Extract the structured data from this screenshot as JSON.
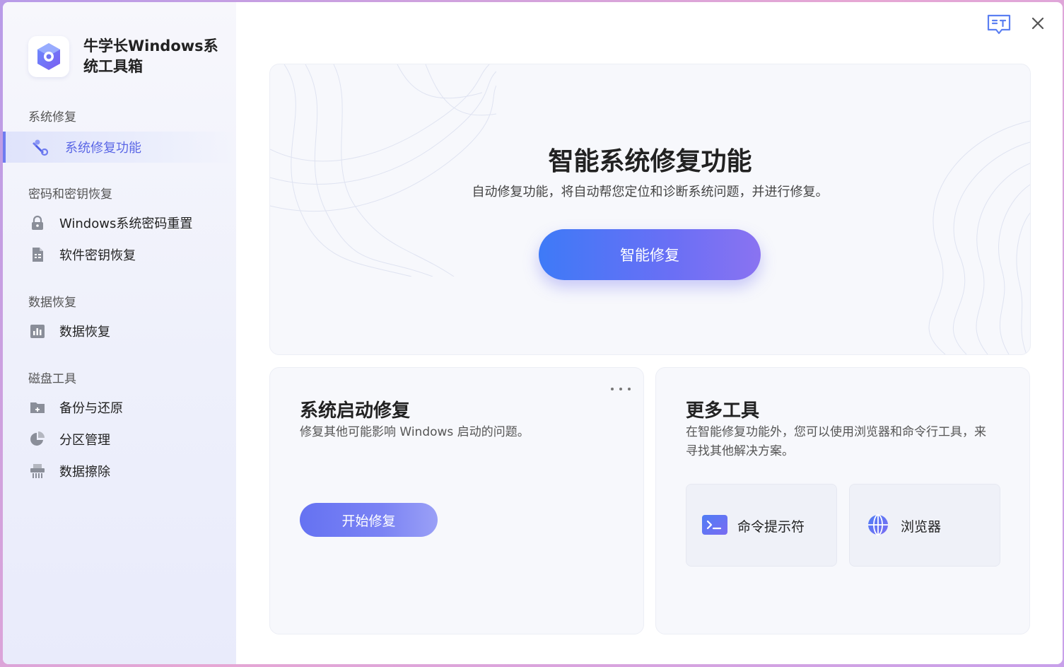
{
  "app": {
    "title_line1": "牛学长Windows系",
    "title_line2": "统工具箱"
  },
  "sidebar": {
    "groups": [
      {
        "title": "系统修复",
        "items": [
          {
            "label": "系统修复功能",
            "icon": "wrench-icon",
            "active": true
          }
        ]
      },
      {
        "title": "密码和密钥恢复",
        "items": [
          {
            "label": "Windows系统密码重置",
            "icon": "lock-icon"
          },
          {
            "label": "软件密钥恢复",
            "icon": "document-icon"
          }
        ]
      },
      {
        "title": "数据恢复",
        "items": [
          {
            "label": "数据恢复",
            "icon": "bar-chart-icon"
          }
        ]
      },
      {
        "title": "磁盘工具",
        "items": [
          {
            "label": "备份与还原",
            "icon": "folder-icon"
          },
          {
            "label": "分区管理",
            "icon": "pie-chart-icon"
          },
          {
            "label": "数据擦除",
            "icon": "shredder-icon"
          }
        ]
      }
    ]
  },
  "hero": {
    "title": "智能系统修复功能",
    "description": "自动修复功能，将自动帮您定位和诊断系统问题，并进行修复。",
    "button": "智能修复"
  },
  "boot_repair": {
    "title": "系统启动修复",
    "description": "修复其他可能影响 Windows 启动的问题。",
    "button": "开始修复"
  },
  "more_tools": {
    "title": "更多工具",
    "description": "在智能修复功能外，您可以使用浏览器和命令行工具，来寻找其他解决方案。",
    "tools": [
      {
        "label": "命令提示符",
        "icon": "terminal-icon"
      },
      {
        "label": "浏览器",
        "icon": "globe-icon"
      }
    ]
  },
  "colors": {
    "accent": "#5b67e6",
    "primary_gradient_start": "#3e7af7",
    "primary_gradient_end": "#8a73f1"
  }
}
